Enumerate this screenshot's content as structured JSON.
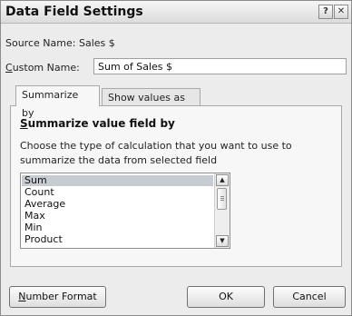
{
  "window": {
    "title": "Data Field Settings",
    "help_label": "?",
    "close_label": "✕"
  },
  "source": {
    "label": "Source Name:",
    "value": "Sales $"
  },
  "custom": {
    "label_first": "C",
    "label_rest": "ustom Name:",
    "value": "Sum of Sales $"
  },
  "tabs": [
    {
      "label": "Summarize by"
    },
    {
      "label": "Show values as"
    }
  ],
  "summarize": {
    "heading_first": "S",
    "heading_rest": "ummarize value field by",
    "description": "Choose the type of calculation that you want to use to summarize the data from selected field",
    "options": [
      "Sum",
      "Count",
      "Average",
      "Max",
      "Min",
      "Product"
    ],
    "selected": "Sum"
  },
  "buttons": {
    "number_format_first": "N",
    "number_format_rest": "umber Format",
    "ok": "OK",
    "cancel": "Cancel"
  },
  "icons": {
    "scroll_up": "▲",
    "scroll_down": "▼"
  }
}
